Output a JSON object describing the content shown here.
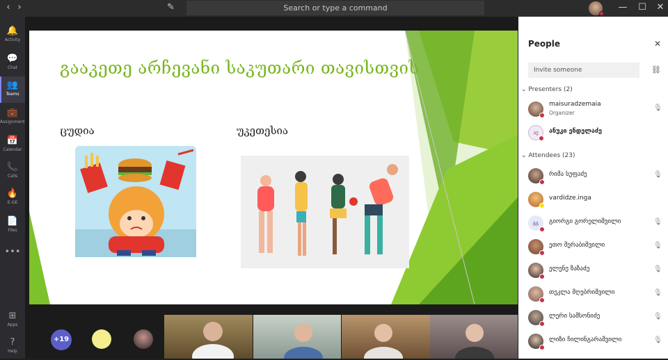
{
  "search": {
    "placeholder": "Search or type a command"
  },
  "rail": [
    {
      "icon": "🔔",
      "label": "Activity"
    },
    {
      "icon": "💬",
      "label": "Chat"
    },
    {
      "icon": "👥",
      "label": "Teams"
    },
    {
      "icon": "💼",
      "label": "Assignments"
    },
    {
      "icon": "📅",
      "label": "Calendar"
    },
    {
      "icon": "📞",
      "label": "Calls"
    },
    {
      "icon": "🔥",
      "label": "E-GE"
    },
    {
      "icon": "📄",
      "label": "Files"
    },
    {
      "icon": "•••",
      "label": ""
    },
    {
      "icon": "⊞",
      "label": "Apps"
    },
    {
      "icon": "?",
      "label": "Help"
    }
  ],
  "slide": {
    "title": "გააკეთე არჩევანი საკუთარი თავისთვის",
    "left_heading": "ცუდია",
    "right_heading": "უკეთესია"
  },
  "thumbs": {
    "more_label": "+19"
  },
  "panel": {
    "title": "People",
    "invite_placeholder": "Invite someone",
    "presenters_label": "Presenters (2)",
    "attendees_label": "Attendees (23)",
    "presenters": [
      {
        "name": "maisuradzemaia",
        "role": "Organizer",
        "initials": "",
        "status_color": "#c4314b"
      },
      {
        "name": "ანუკი ენდელაძე",
        "role": "",
        "initials": "აე",
        "status_color": "#c4314b"
      }
    ],
    "attendees": [
      {
        "name": "რიმა სუფაძე",
        "initials": "",
        "status_color": "#c4314b"
      },
      {
        "name": "vardidze.inga",
        "initials": "",
        "status_color": "#fce100"
      },
      {
        "name": "გიორგი გორელიშვილი",
        "initials": "გგ",
        "status_color": "#c4314b"
      },
      {
        "name": "ეთო მერაბიშვილი",
        "initials": "",
        "status_color": "#c4314b"
      },
      {
        "name": "ელენე ზაზაძე",
        "initials": "",
        "status_color": "#c4314b"
      },
      {
        "name": "თეკლა მღებრიშვილი",
        "initials": "",
        "status_color": "#c4314b"
      },
      {
        "name": "ლერი სამსონიძე",
        "initials": "",
        "status_color": "#c4314b"
      },
      {
        "name": "ლიზი ჩილინგარაშვილი",
        "initials": "",
        "status_color": "#c4314b"
      }
    ]
  }
}
